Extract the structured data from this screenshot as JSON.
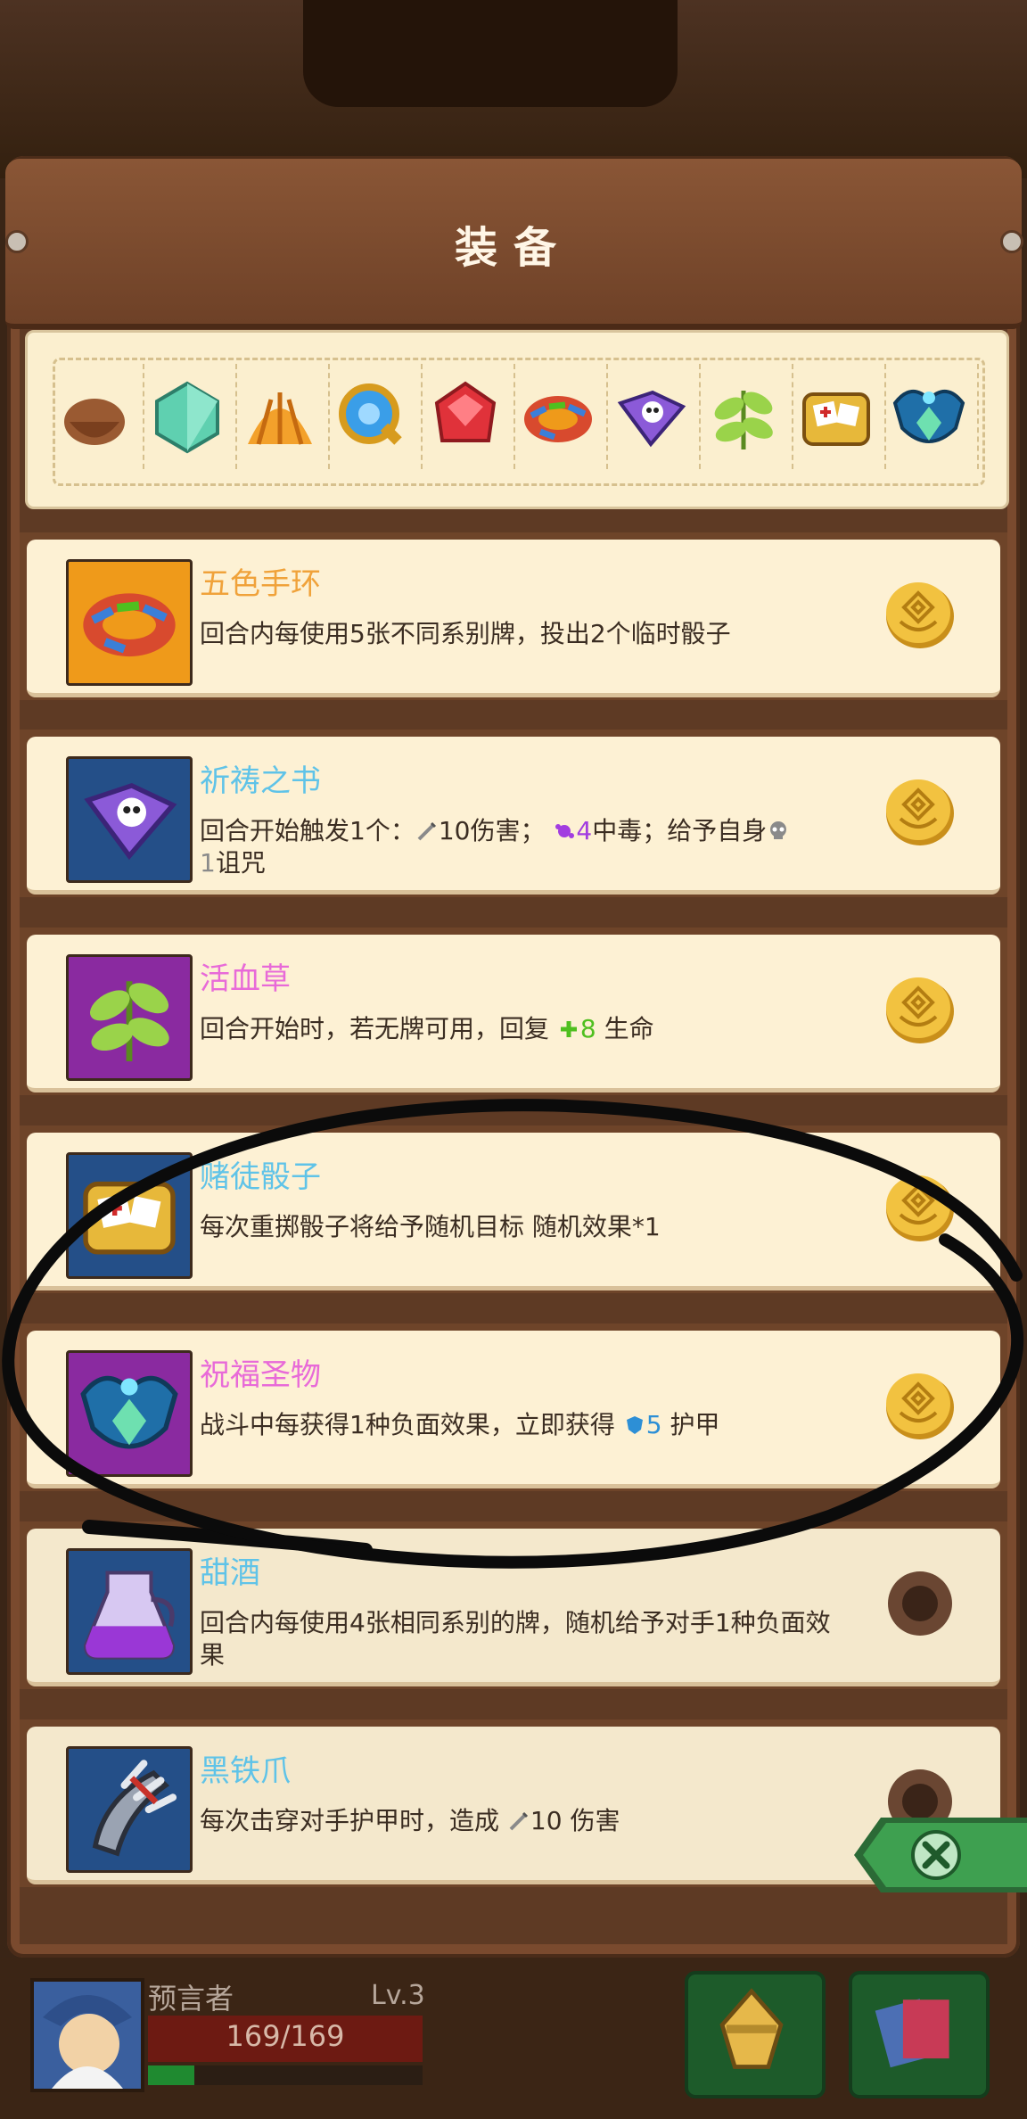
{
  "header": {
    "title": "装备"
  },
  "strip": {
    "icons": [
      "leather-bag-icon",
      "green-gem-icon",
      "striped-shell-icon",
      "blue-amulet-icon",
      "red-ruby-icon",
      "five-color-bracelet-icon",
      "prayer-book-icon",
      "blood-herb-icon",
      "gambler-dice-icon",
      "blessed-relic-icon"
    ]
  },
  "items": [
    {
      "name": "五色手环",
      "title_color": "#f0a23a",
      "desc": "回合内每使用5张不同系别牌，投出2个临时骰子",
      "icon": "five-color-bracelet-icon",
      "thumb_bg": "#ef9a1a",
      "owned": true
    },
    {
      "name": "祈祷之书",
      "title_color": "#5fc3e8",
      "desc_parts": [
        "回合开始触发1个：",
        "10",
        "伤害；",
        "4",
        "中毒；给予自身",
        "1",
        "诅咒"
      ],
      "icon": "prayer-book-icon",
      "thumb_bg": "#244f88",
      "owned": true
    },
    {
      "name": "活血草",
      "title_color": "#e86ad8",
      "desc_parts": [
        "回合开始时，若无牌可用，回复 ",
        "8",
        " 生命"
      ],
      "icon": "blood-herb-icon",
      "thumb_bg": "#8a2aa0",
      "owned": true
    },
    {
      "name": "赌徒骰子",
      "title_color": "#5fc3e8",
      "desc": "每次重掷骰子将给予随机目标 随机效果*1",
      "icon": "gambler-dice-icon",
      "thumb_bg": "#244f88",
      "owned": true
    },
    {
      "name": "祝福圣物",
      "title_color": "#e86ad8",
      "desc_parts": [
        "战斗中每获得1种负面效果，立即获得 ",
        "5",
        " 护甲"
      ],
      "icon": "blessed-relic-icon",
      "thumb_bg": "#8a2aa0",
      "owned": true
    },
    {
      "name": "甜酒",
      "title_color": "#5fc3e8",
      "desc": "回合内每使用4张相同系别的牌，随机给予对手1种负面效果",
      "icon": "sweet-wine-icon",
      "thumb_bg": "#244f88",
      "owned": false
    },
    {
      "name": "黑铁爪",
      "title_color": "#5fc3e8",
      "desc_parts": [
        "每次击穿对手护甲时，造成 ",
        "10",
        " 伤害"
      ],
      "icon": "black-iron-claw-icon",
      "thumb_bg": "#244f88",
      "owned": false
    }
  ],
  "player": {
    "name": "预言者",
    "level": "Lv.3",
    "hp": "169/169",
    "xp_fraction": 0.17
  },
  "colors": {
    "accent_green": "#1f8a30",
    "poison_purple": "#a23de0",
    "heal_green": "#4fbf1f",
    "armor_blue": "#2d8fd6"
  }
}
